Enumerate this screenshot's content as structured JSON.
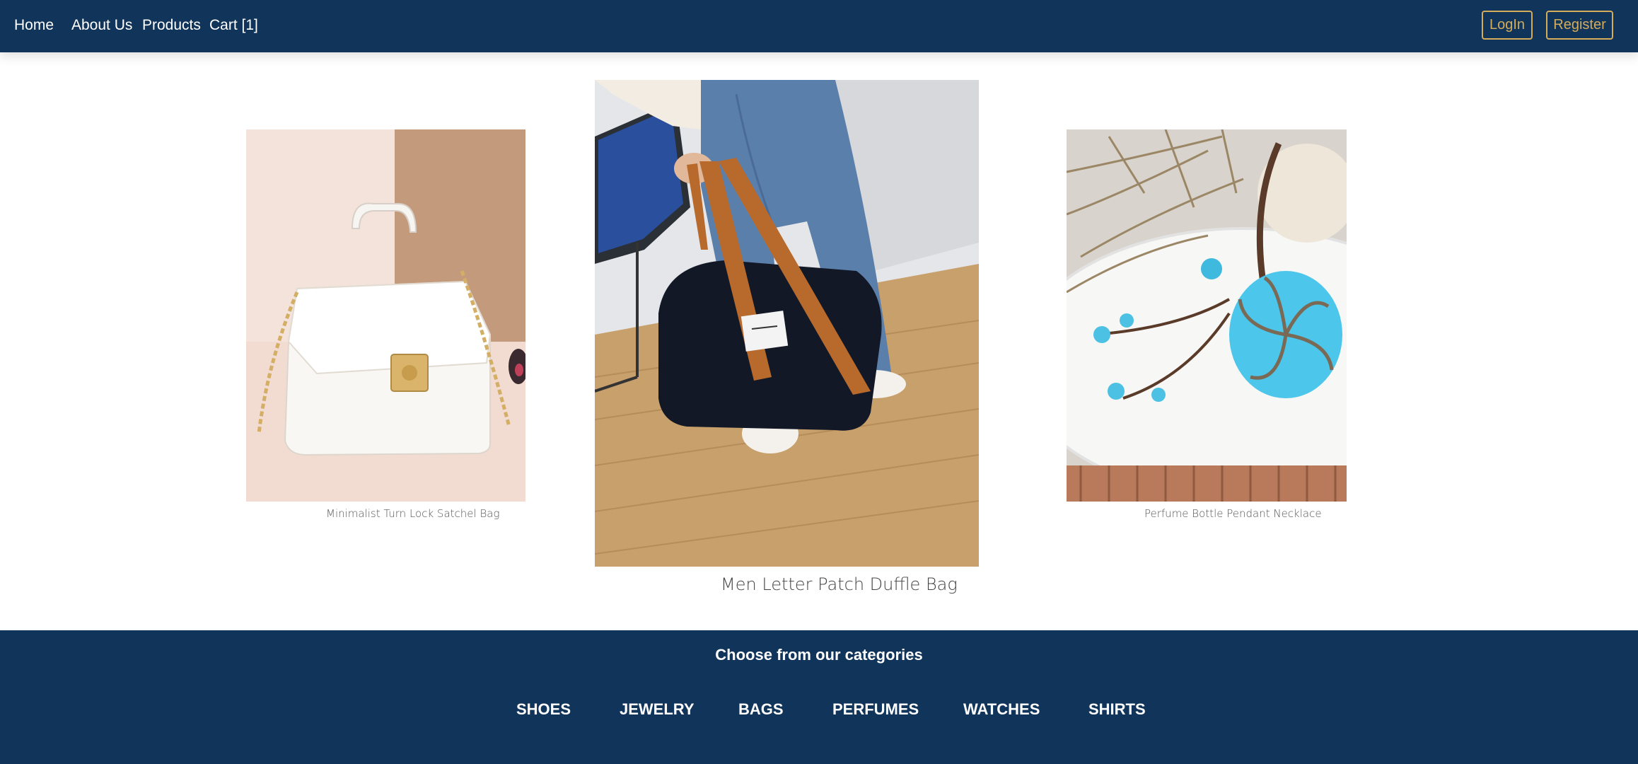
{
  "nav": {
    "home": "Home",
    "about": "About Us",
    "products": "Products",
    "cart": "Cart [1]",
    "login": "LogIn",
    "register": "Register"
  },
  "products": [
    {
      "name": "Minimalist Turn Lock Satchel Bag"
    },
    {
      "name": "Men Letter Patch Duffle Bag"
    },
    {
      "name": "Perfume Bottle Pendant Necklace"
    }
  ],
  "categories": {
    "title": "Choose from our categories",
    "items": [
      "SHOES",
      "JEWELRY",
      "BAGS",
      "PERFUMES",
      "WATCHES",
      "SHIRTS"
    ]
  },
  "colors": {
    "navy": "#11345a",
    "gold_accent": "#d4ac5a",
    "white": "#ffffff"
  }
}
